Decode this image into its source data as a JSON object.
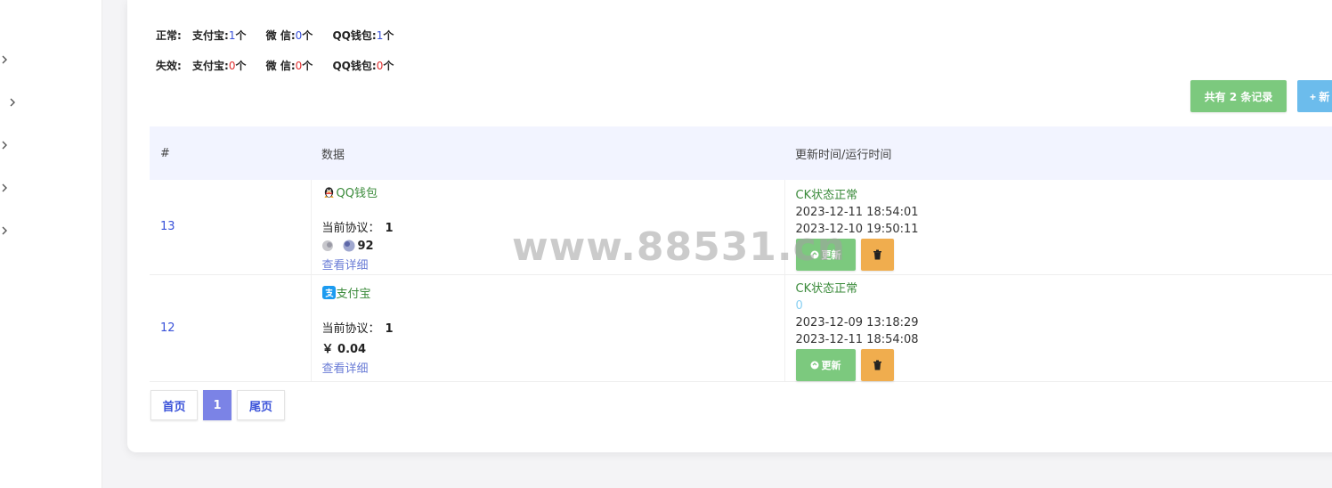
{
  "stats": {
    "normal": {
      "label": "正常:",
      "items": [
        {
          "name": "支付宝:",
          "count": "1",
          "unit": "个"
        },
        {
          "name": "微 信:",
          "count": "0",
          "unit": "个"
        },
        {
          "name": "QQ钱包:",
          "count": "1",
          "unit": "个"
        }
      ]
    },
    "invalid": {
      "label": "失效:",
      "items": [
        {
          "name": "支付宝:",
          "count": "0",
          "unit": "个"
        },
        {
          "name": "微 信:",
          "count": "0",
          "unit": "个"
        },
        {
          "name": "QQ钱包:",
          "count": "0",
          "unit": "个"
        }
      ]
    }
  },
  "toolbar": {
    "total_label": "共有 2 条记录",
    "add_label": "+ 新"
  },
  "table": {
    "headers": [
      "#",
      "数据",
      "更新时间/运行时间"
    ],
    "rows": [
      {
        "id": "13",
        "pay_type": "QQ钱包",
        "pay_icon": "qq-penguin-icon",
        "protocol_label": "当前协议：",
        "protocol_value": "1",
        "balance": "92",
        "detail_label": "查看详细",
        "status": "CK状态正常",
        "extra": "",
        "time1": "2023-12-11 18:54:01",
        "time2": "2023-12-10 19:50:11",
        "update_label": "更新"
      },
      {
        "id": "12",
        "pay_type": "支付宝",
        "pay_icon": "alipay-icon",
        "protocol_label": "当前协议：",
        "protocol_value": "1",
        "balance": "￥ 0.04",
        "detail_label": "查看详细",
        "status": "CK状态正常",
        "extra": "0",
        "time1": "2023-12-09 13:18:29",
        "time2": "2023-12-11 18:54:08",
        "update_label": "更新"
      }
    ]
  },
  "pagination": {
    "first_label": "首页",
    "current": "1",
    "last_label": "尾页"
  },
  "watermark": "www.88531.cn",
  "colors": {
    "green": "#7cc97e",
    "blue": "#6cbcec",
    "orange": "#f0ad4e",
    "link": "#3a52d9",
    "active_page": "#7b83e6"
  }
}
